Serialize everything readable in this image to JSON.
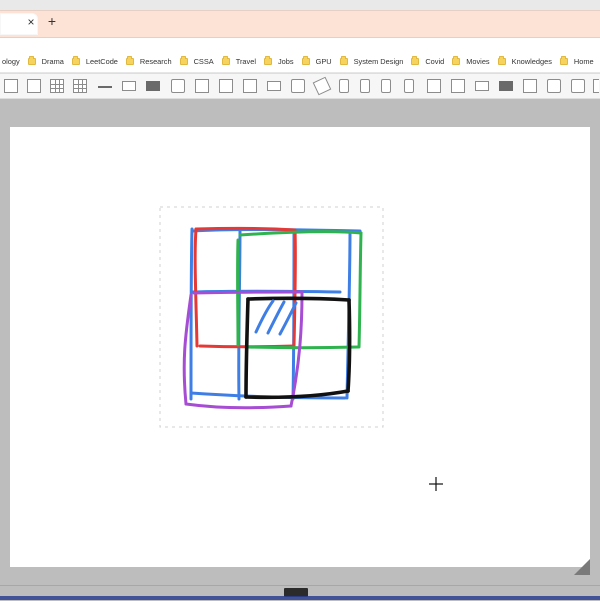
{
  "browser": {
    "tab": {
      "close_glyph": "×",
      "new_tab_glyph": "+"
    },
    "bookmarks": [
      {
        "label": "ology",
        "icon": "none"
      },
      {
        "label": "Drama",
        "icon": "folder-icon"
      },
      {
        "label": "LeetCode",
        "icon": "folder-icon"
      },
      {
        "label": "Research",
        "icon": "folder-icon"
      },
      {
        "label": "CSSA",
        "icon": "folder-icon"
      },
      {
        "label": "Travel",
        "icon": "folder-icon"
      },
      {
        "label": "Jobs",
        "icon": "folder-icon"
      },
      {
        "label": "GPU",
        "icon": "folder-icon"
      },
      {
        "label": "System Design",
        "icon": "folder-icon"
      },
      {
        "label": "Covid",
        "icon": "folder-icon"
      },
      {
        "label": "Movies",
        "icon": "folder-icon"
      },
      {
        "label": "Knowledges",
        "icon": "folder-icon"
      },
      {
        "label": "Home",
        "icon": "folder-icon"
      },
      {
        "label": "",
        "icon": "globe-icon"
      }
    ]
  },
  "toolbar": {
    "tools": [
      {
        "name": "corner-shape-tool-icon"
      },
      {
        "name": "layout-tool-icon"
      },
      {
        "name": "grid-tool-icon"
      },
      {
        "name": "table-tool-icon"
      },
      {
        "name": "line-tool-icon"
      },
      {
        "name": "stack-tool-icon"
      },
      {
        "name": "bar-tool-icon"
      },
      {
        "name": "calendar-tool-icon"
      },
      {
        "name": "device-tool-icon"
      },
      {
        "name": "panel-tool-icon"
      },
      {
        "name": "window-tool-icon"
      },
      {
        "name": "keyboard-tool-icon"
      },
      {
        "name": "tablet-tool-icon"
      },
      {
        "name": "brush-tool-icon"
      },
      {
        "name": "mouse-tool-icon"
      },
      {
        "name": "mouse-outline-tool-icon"
      },
      {
        "name": "mouse-small-tool-icon"
      },
      {
        "name": "phone-tool-icon"
      },
      {
        "name": "monitor-tool-icon"
      },
      {
        "name": "desktop-tool-icon"
      },
      {
        "name": "projector-tool-icon"
      },
      {
        "name": "speaker-tool-icon"
      },
      {
        "name": "printer-tool-icon"
      },
      {
        "name": "calculator-tool-icon"
      },
      {
        "name": "calculator-alt-tool-icon"
      },
      {
        "name": "more-tools-icon"
      }
    ]
  },
  "colors": {
    "tabstrip": "#fde2d6",
    "toolbar": "#f6f6f6",
    "canvas_bg": "#bdbdbd",
    "stroke_red": "#e53935",
    "stroke_blue": "#3f7fe5",
    "stroke_green": "#2fb34f",
    "stroke_purple": "#a64dd4",
    "stroke_black": "#111111"
  },
  "canvas": {
    "cursor": "crosshair",
    "cursor_glyph": "+"
  }
}
